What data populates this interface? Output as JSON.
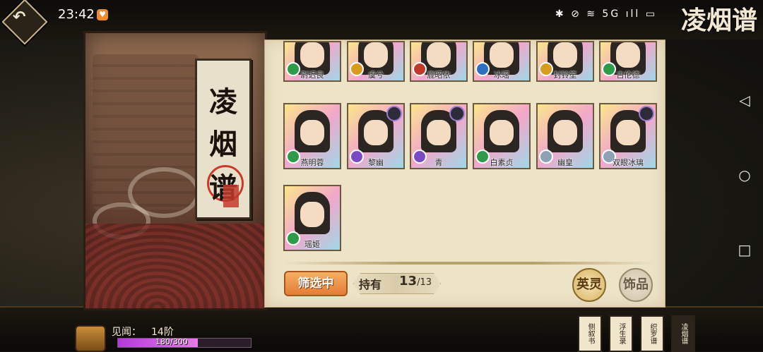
{
  "status": {
    "time": "23:42",
    "badge": "♥",
    "right": "✱ ⊘ ≋ 5G ıll ▭"
  },
  "logo": "凌烟谱",
  "left_panel": {
    "title": [
      "凌",
      "烟",
      "谱"
    ]
  },
  "heroes": [
    {
      "name": "尉迟良",
      "element": "green",
      "partial": true
    },
    {
      "name": "虞兮",
      "element": "gold",
      "partial": true
    },
    {
      "name": "鹿昭依",
      "element": "red",
      "partial": true
    },
    {
      "name": "冰瑶",
      "element": "blue",
      "partial": true
    },
    {
      "name": "封铃笙",
      "element": "gold",
      "partial": true
    },
    {
      "name": "古伦德",
      "element": "green",
      "partial": true
    },
    {
      "name": "燕明蓉",
      "element": "green",
      "partial": false
    },
    {
      "name": "黎幽",
      "element": "purple",
      "partial": false
    },
    {
      "name": "青",
      "element": "purple",
      "partial": false
    },
    {
      "name": "白素贞",
      "element": "green",
      "partial": false
    },
    {
      "name": "幽皇",
      "element": "silver",
      "partial": false
    },
    {
      "name": "双眼冰璃",
      "element": "silver",
      "partial": false
    },
    {
      "name": "瑶姬",
      "element": "green",
      "partial": false
    }
  ],
  "element_colors": {
    "green": "#2f9a4a",
    "gold": "#d89b1e",
    "red": "#c0392b",
    "blue": "#2e6fbf",
    "purple": "#7a4bc4",
    "silver": "#8fa2b5"
  },
  "controls": {
    "filter_label": "筛选中",
    "own_label": "持有",
    "own_count": "13",
    "own_total": "/13",
    "btn_spirit": "英灵",
    "btn_ornament": "饰品"
  },
  "footer": {
    "xp_label": "见闻：",
    "xp_rank": "14阶",
    "xp_value": "180/300",
    "xp_progress": 0.6,
    "books": [
      "侧叙书",
      "浮生录",
      "织罗谱",
      "凌烟谱"
    ]
  }
}
